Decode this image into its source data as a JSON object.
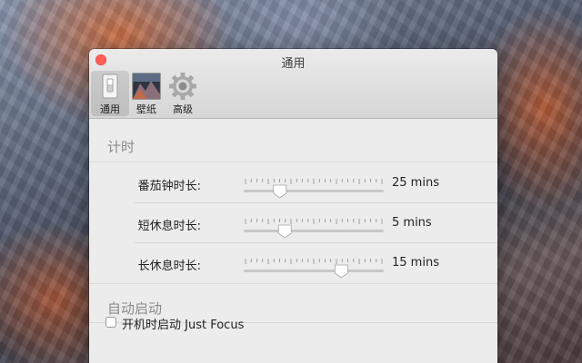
{
  "window": {
    "title": "通用"
  },
  "tabs": [
    {
      "label": "通用",
      "active": true
    },
    {
      "label": "壁纸",
      "active": false
    },
    {
      "label": "高级",
      "active": false
    }
  ],
  "sections": {
    "timer": {
      "title": "计时",
      "rows": [
        {
          "label": "番茄钟时长:",
          "value": "25 mins",
          "slider_fraction": 0.23
        },
        {
          "label": "短休息时长:",
          "value": "5 mins",
          "slider_fraction": 0.27
        },
        {
          "label": "长休息时长:",
          "value": "15 mins",
          "slider_fraction": 0.72
        }
      ]
    },
    "autostart": {
      "title": "自动启动",
      "checkbox": {
        "label": "开机时启动 Just Focus",
        "checked": false
      }
    }
  },
  "colors": {
    "close": "#fc5f57",
    "accent_slider_track": "#c8c8c8"
  },
  "icons": {
    "general": "toggle-switch-icon",
    "wallpaper": "landscape-thumbnail-icon",
    "advanced": "gear-icon"
  }
}
